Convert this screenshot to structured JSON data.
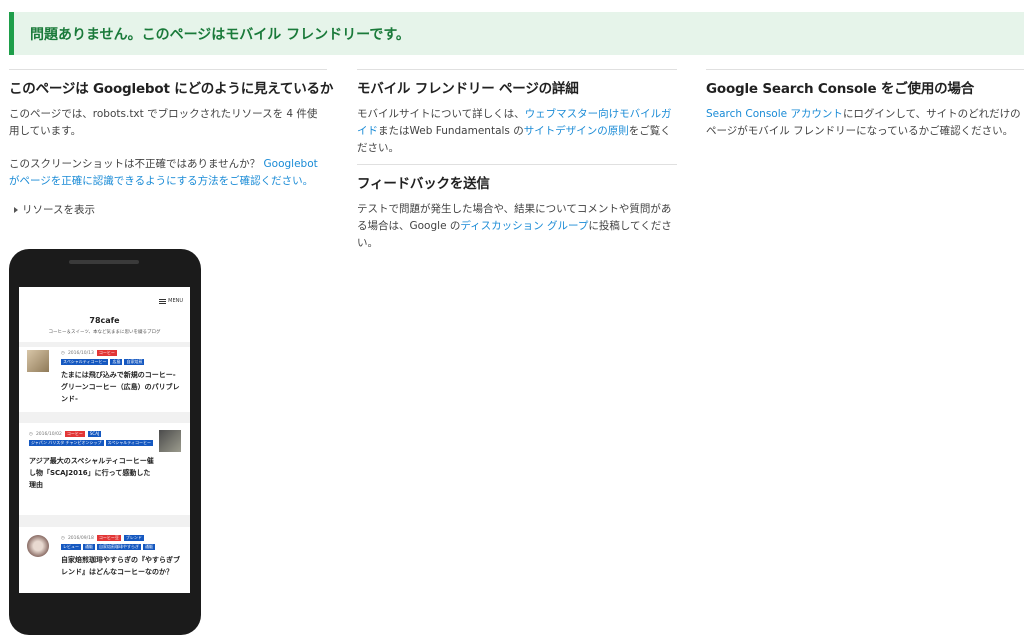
{
  "banner": {
    "text": "問題ありません。このページはモバイル フレンドリーです。"
  },
  "col1": {
    "heading": "このページは Googlebot にどのように見えているか",
    "p1": "このページでは、robots.txt でブロックされたリソースを 4 件使用しています。",
    "p2_text": "このスクリーンショットは不正確ではありませんか？",
    "p2_link": "Googlebot がページを正確に認識できるようにする方法をご確認ください。",
    "toggle": "リソースを表示"
  },
  "col2": {
    "heading1": "モバイル フレンドリー ページの詳細",
    "p1_a": "モバイルサイトについて詳しくは、",
    "p1_link1": "ウェブマスター向けモバイルガイド",
    "p1_b": "またはWeb Fundamentals の",
    "p1_link2": "サイトデザインの原則",
    "p1_c": "をご覧ください。",
    "heading2": "フィードバックを送信",
    "p2_a": "テストで問題が発生した場合や、結果についてコメントや質問がある場合は、Google の",
    "p2_link": "ディスカッション グループ",
    "p2_b": "に投稿してください。"
  },
  "col3": {
    "heading": "Google Search Console をご使用の場合",
    "p_link": "Search Console アカウント",
    "p_text": "にログインして、サイトのどれだけのページがモバイル フレンドリーになっているかご確認ください。"
  },
  "phone": {
    "menu": "MENU",
    "site_title": "78cafe",
    "site_sub": "コーヒー＆スイーツ、本など気ままに思いを綴るブログ",
    "cards": [
      {
        "date": "2016/10/13",
        "tags_red": [
          "コーヒー"
        ],
        "tags_blue": [
          "スペシャルティコーヒー",
          "広島",
          "自家焙煎"
        ],
        "title": "たまには飛び込みで新規のコーヒー-グリーンコーヒー（広島）のパリブレンド-"
      },
      {
        "date": "2016/10/02",
        "tags_red": [
          "コーヒー"
        ],
        "tags_blue": [
          "SCAJ",
          "ジャパン バリスタ チャンピオンシップ",
          "スペシャルティコーヒー"
        ],
        "title": "アジア最大のスペシャルティコーヒー催し物「SCAJ2016」に行って感動した理由"
      },
      {
        "date": "2016/09/18",
        "tags_red": [
          "コーヒー豆"
        ],
        "tags_blue": [
          "ブレンド",
          "レビュー",
          "通販",
          "自家焙煎珈琲やすらぎ",
          "通販"
        ],
        "title": "自家焙煎珈琲やすらぎの『やすらぎブレンド』はどんなコーヒーなのか？"
      }
    ]
  }
}
